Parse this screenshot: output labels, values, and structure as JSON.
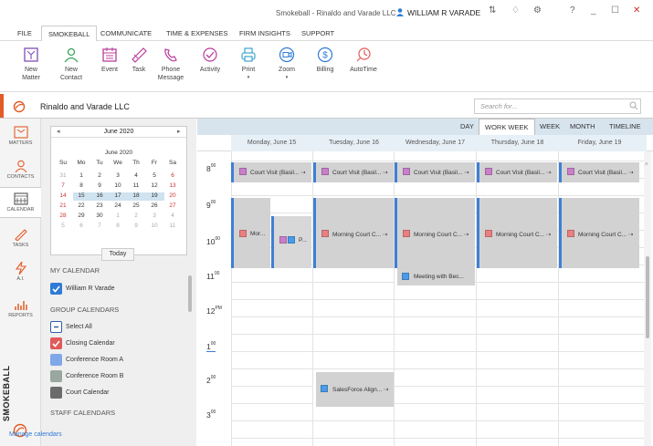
{
  "window": {
    "title": "Smokeball - Rinaldo and Varade LLC",
    "user": "WILLIAM R VARADE"
  },
  "menu": [
    "FILE",
    "SMOKEBALL",
    "COMMUNICATE",
    "TIME & EXPENSES",
    "FIRM INSIGHTS",
    "SUPPORT"
  ],
  "menu_active": "SMOKEBALL",
  "ribbon": {
    "new_matter": "New Matter",
    "new_contact": "New Contact",
    "event": "Event",
    "task": "Task",
    "phone_message": "Phone Message",
    "activity": "Activity",
    "print": "Print",
    "zoom": "Zoom",
    "billing": "Billing",
    "autotime": "AutoTime"
  },
  "matter": {
    "title": "Rinaldo and Varade LLC",
    "search_placeholder": "Search for..."
  },
  "nav": [
    "MATTERS",
    "CONTACTS",
    "CALENDAR",
    "TASKS",
    "A.I.",
    "REPORTS"
  ],
  "nav_active": "CALENDAR",
  "brand": "SMOKEBALL",
  "minical": {
    "header_month": "June 2020",
    "title_month": "June 2020",
    "dow": [
      "Su",
      "Mo",
      "Tu",
      "We",
      "Th",
      "Fr",
      "Sa"
    ],
    "weeks": [
      [
        "31",
        "1",
        "2",
        "3",
        "4",
        "5",
        "6"
      ],
      [
        "7",
        "8",
        "9",
        "10",
        "11",
        "12",
        "13"
      ],
      [
        "14",
        "15",
        "16",
        "17",
        "18",
        "19",
        "20"
      ],
      [
        "21",
        "22",
        "23",
        "24",
        "25",
        "26",
        "27"
      ],
      [
        "28",
        "29",
        "30",
        "1",
        "2",
        "3",
        "4"
      ],
      [
        "5",
        "6",
        "7",
        "8",
        "9",
        "10",
        "11"
      ]
    ],
    "today_label": "Today"
  },
  "sections": {
    "my_calendar": "MY CALENDAR",
    "group_calendars": "GROUP CALENDARS",
    "staff_calendars": "STAFF CALENDARS",
    "manage": "Manage calendars"
  },
  "my_calendars": [
    {
      "label": "William R Varade",
      "color": "#2f7bd5",
      "checked": true
    }
  ],
  "group_calendars": [
    {
      "label": "Select All",
      "color": "#ffffff",
      "checked": false
    },
    {
      "label": "Closing Calendar",
      "color": "#e05a5a",
      "checked": true
    },
    {
      "label": "Conference Room A",
      "color": "#7fa8e8",
      "checked": false
    },
    {
      "label": "Conference Room B",
      "color": "#9aa6a0",
      "checked": false
    },
    {
      "label": "Court Calendar",
      "color": "#6b6b6b",
      "checked": false
    }
  ],
  "view_tabs": [
    "DAY",
    "WORK WEEK",
    "WEEK",
    "MONTH",
    "TIMELINE"
  ],
  "view_active": "WORK WEEK",
  "days": [
    "Monday, June 15",
    "Tuesday, June 16",
    "Wednesday, June 17",
    "Thursday, June 18",
    "Friday, June 19"
  ],
  "hours": [
    {
      "num": "8",
      "sup": "00"
    },
    {
      "num": "9",
      "sup": "00"
    },
    {
      "num": "10",
      "sup": "00"
    },
    {
      "num": "11",
      "sup": "00"
    },
    {
      "num": "12",
      "sup": "PM"
    },
    {
      "num": "1",
      "sup": "00"
    },
    {
      "num": "2",
      "sup": "00"
    },
    {
      "num": "3",
      "sup": "00"
    }
  ],
  "events": {
    "court_visit": "Court Visit (Basil... ⇢",
    "mor": "Mor...",
    "p": "P...",
    "morning_court": "Morning Court C... ⇢",
    "meeting": "Meeting with Bec...",
    "salesforce": "SalesForce Align... ⇢"
  },
  "colors": {
    "accent": "#e35b27",
    "blue": "#3e7fd6",
    "event_bg": "#d2d2d2",
    "court_sq": "#c97fc9",
    "morning_sq": "#e88080",
    "meeting_sq": "#4a9be8"
  }
}
